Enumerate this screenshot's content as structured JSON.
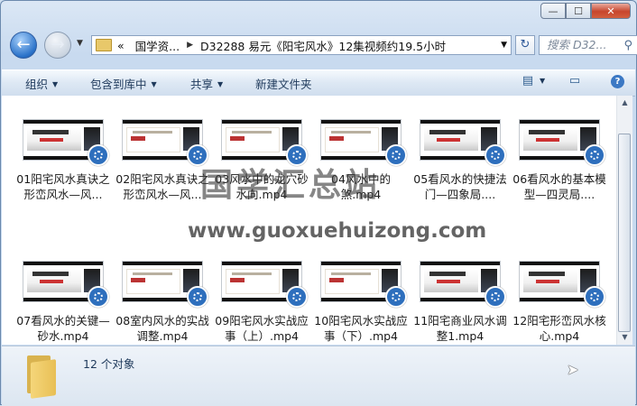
{
  "window": {
    "controls": {
      "minimize": "—",
      "maximize": "☐",
      "close": "✕"
    }
  },
  "nav": {
    "back_icon": "back-arrow-icon",
    "forward_icon": "forward-arrow-icon",
    "overflow": "«",
    "breadcrumbs": [
      "国学资...",
      "D32288 易元《阳宅风水》12集视频约19.5小时"
    ],
    "search_placeholder": "搜索 D32...",
    "refresh_icon": "refresh-icon"
  },
  "toolbar": {
    "organize": "组织",
    "include_library": "包含到库中",
    "share": "共享",
    "new_folder": "新建文件夹"
  },
  "files": [
    {
      "name": "01阳宅风水真诀之形峦风水—风..."
    },
    {
      "name": "02阳宅风水真诀之形峦风水—风..."
    },
    {
      "name": "03风水中的龙穴砂水向.mp4"
    },
    {
      "name": "04风水中的煞.mp4"
    },
    {
      "name": "05看风水的快捷法门—四象局...."
    },
    {
      "name": "06看风水的基本模型—四灵局...."
    },
    {
      "name": "07看风水的关键—砂水.mp4"
    },
    {
      "name": "08室内风水的实战调整.mp4"
    },
    {
      "name": "09阳宅风水实战应事（上）.mp4"
    },
    {
      "name": "10阳宅风水实战应事（下）.mp4"
    },
    {
      "name": "11阳宅商业风水调整1.mp4"
    },
    {
      "name": "12阳宅形峦风水核心.mp4"
    }
  ],
  "watermark": {
    "cn": "国学汇总站",
    "url": "www.guoxuehuizong.com"
  },
  "status": {
    "count": "12 个对象"
  }
}
